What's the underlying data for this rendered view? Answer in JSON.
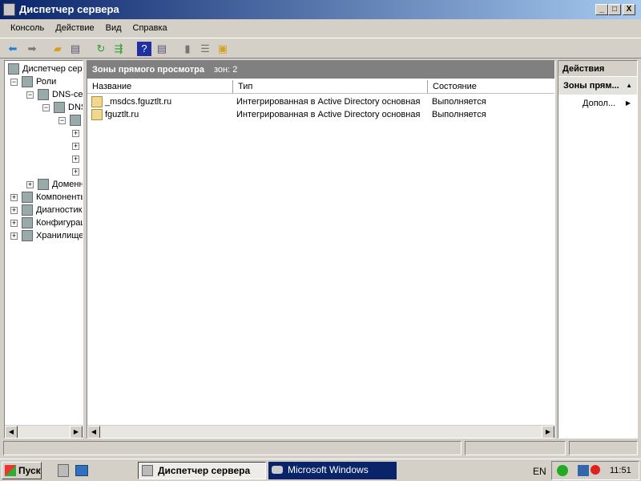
{
  "window": {
    "title": "Диспетчер сервера",
    "min": "_",
    "max": "□",
    "close": "X"
  },
  "menu": [
    "Консоль",
    "Действие",
    "Вид",
    "Справка"
  ],
  "tree": {
    "root": "Диспетчер сервера",
    "roles": "Роли",
    "dns1": "DNS-сервер",
    "dns2": "DNS",
    "domain": "Доменные службы",
    "components": "Компоненты",
    "diagnostics": "Диагностика",
    "config": "Конфигурация",
    "storage": "Хранилище"
  },
  "center": {
    "header": "Зоны прямого просмотра",
    "count": "зон: 2",
    "columns": [
      "Название",
      "Тип",
      "Состояние"
    ],
    "rows": [
      {
        "name": "_msdcs.fguztlt.ru",
        "type": "Интегрированная в Active Directory основная",
        "state": "Выполняется"
      },
      {
        "name": "fguztlt.ru",
        "type": "Интегрированная в Active Directory основная",
        "state": "Выполняется"
      }
    ]
  },
  "actions": {
    "title": "Действия",
    "section": "Зоны прям...",
    "more": "Допол..."
  },
  "taskbar": {
    "start": "Пуск",
    "tasks": [
      "Диспетчер сервера",
      "Microsoft Windows"
    ],
    "lang": "EN",
    "time": "11:51"
  }
}
